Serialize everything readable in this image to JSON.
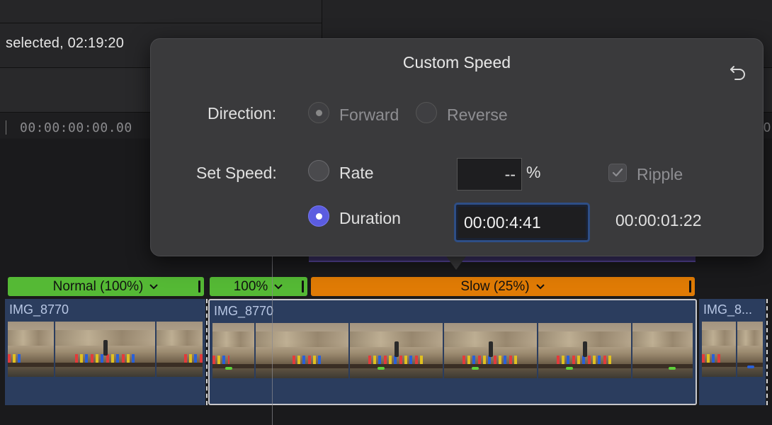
{
  "header": {
    "selection_text": "selected, 02:19:20"
  },
  "ruler": {
    "timecode": "00:00:00:00.00",
    "right_mark": "0"
  },
  "speed_segments": [
    {
      "label": "Normal (100%)",
      "color": "#55b935"
    },
    {
      "label": "100%",
      "color": "#55b935"
    },
    {
      "label": "Slow (25%)",
      "color": "#e07b05"
    }
  ],
  "clips": [
    {
      "name": "IMG_8770"
    },
    {
      "name": "IMG_8770"
    },
    {
      "name": "IMG_8..."
    }
  ],
  "popover": {
    "title": "Custom Speed",
    "direction_label": "Direction:",
    "forward_label": "Forward",
    "reverse_label": "Reverse",
    "set_speed_label": "Set Speed:",
    "rate_label": "Rate",
    "rate_value": "--",
    "percent_symbol": "%",
    "ripple_label": "Ripple",
    "duration_label": "Duration",
    "duration_value": "00:00:4:41",
    "original_duration": "00:00:01:22",
    "selected_mode": "duration",
    "accent_color": "#5b5ce0"
  }
}
